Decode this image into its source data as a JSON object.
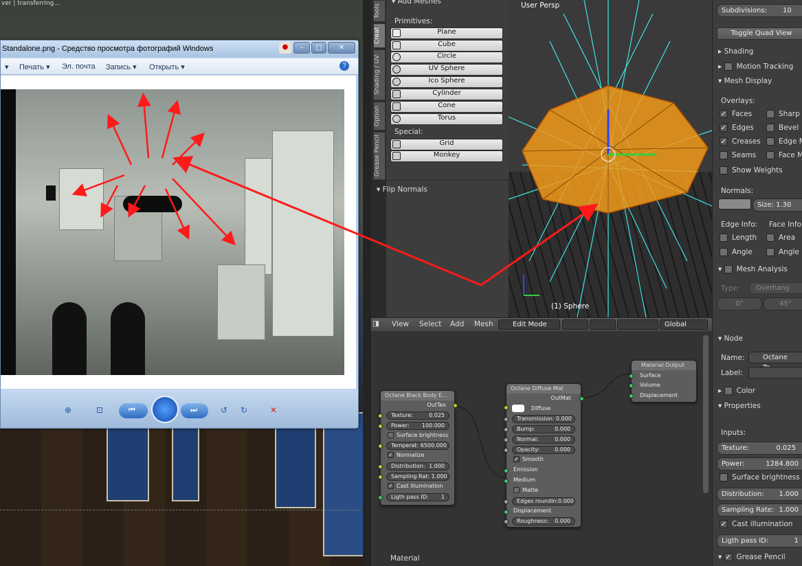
{
  "background": {
    "title_fragment": "ver | transferring..."
  },
  "viewer": {
    "title": "Standalone.png - Средство просмотра фотографий Windows",
    "menu": [
      "Печать ▾",
      "Эл. почта",
      "Запись ▾",
      "Открыть ▾"
    ],
    "help": "?"
  },
  "tool_tabs": [
    "Tools",
    "Creat",
    "Shading / UV",
    "Option",
    "Grease Pencil"
  ],
  "tool_shelf": {
    "header": "▾ Add Meshes",
    "primitives_label": "Primitives:",
    "primitives": [
      "Plane",
      "Cube",
      "Circle",
      "UV Sphere",
      "Ico Sphere",
      "Cylinder",
      "Cone",
      "Torus"
    ],
    "special_label": "Special:",
    "special": [
      "Grid",
      "Monkey"
    ],
    "flip_normals": "▾ Flip Normals"
  },
  "viewport": {
    "label": "User Persp",
    "object": "(1) Sphere"
  },
  "viewport_header": {
    "view": "View",
    "select": "Select",
    "add": "Add",
    "mesh": "Mesh",
    "mode": "Edit Mode",
    "orientation": "Global"
  },
  "props": {
    "subdivisions_label": "Subdivisions:",
    "subdivisions_value": "10",
    "toggle_quad": "Toggle Quad View",
    "shading": "▸ Shading",
    "motion_tracking": "Motion Tracking",
    "mesh_display": "▾ Mesh Display",
    "overlays_label": "Overlays:",
    "overlays_left": [
      "Faces",
      "Edges",
      "Creases",
      "Seams"
    ],
    "overlays_left_checked": [
      true,
      true,
      true,
      false
    ],
    "overlays_right": [
      "Sharp",
      "Bevel",
      "Edge M",
      "Face M"
    ],
    "show_weights": "Show Weights",
    "normals_label": "Normals:",
    "size_label": "Size:",
    "size_value": "1.30",
    "edge_info": "Edge Info:",
    "face_info": "Face Info:",
    "length": "Length",
    "area": "Area",
    "angle_left": "Angle",
    "angle_right": "Angle",
    "mesh_analysis": "Mesh Analysis",
    "type_label": "Type:",
    "type_value": "Overhang",
    "angle_min": "0°",
    "angle_max": "45°"
  },
  "node_props": {
    "node": "▾ Node",
    "name_label": "Name:",
    "name_value": "Octane Te...",
    "label_label": "Label:",
    "color": "Color",
    "properties": "▾ Properties",
    "inputs_label": "Inputs:",
    "texture_label": "Texture:",
    "texture_value": "0.025",
    "power_label": "Power:",
    "power_value": "1284.800",
    "surface_brightness": "Surface brightness",
    "distribution_label": "Distribution:",
    "distribution_value": "1.000",
    "sampling_label": "Sampling Rate:",
    "sampling_value": "1.000",
    "cast_illumination": "Cast illumination",
    "light_pass_label": "Ligth pass ID:",
    "light_pass_value": "1",
    "grease_pencil": "Grease Pencil"
  },
  "node_editor": {
    "footer": "Material",
    "blackbody": {
      "title": "Octane Black Body E...",
      "out": "OutTex",
      "texture": "Texture:",
      "texture_v": "0.025",
      "power": "Power:",
      "power_v": "100.000",
      "surface": "Surface brightness",
      "temperat": "Temperat: 6500.000",
      "normalize": "Normalize",
      "distribution": "Distribution:",
      "distribution_v": "1.000",
      "sampling": "Sampling Rat: 1.000",
      "cast": "Cast illumination",
      "ligth": "Ligth pass ID:",
      "ligth_v": "1"
    },
    "diffuse": {
      "title": "Octane Diffuse Mat",
      "out": "OutMat",
      "diffuse": "Diffuse",
      "transmission": "Transmission: 0.000",
      "bump": "Bump:",
      "bump_v": "0.000",
      "normal": "Normal:",
      "normal_v": "0.000",
      "opacity": "Opacity:",
      "opacity_v": "0.000",
      "smooth": "Smooth",
      "emission": "Emission",
      "medium": "Medium",
      "matte": "Matte",
      "edges": "Edges roundin:0.000",
      "displacement": "Displacement",
      "roughness": "Roughness:",
      "roughness_v": "0.000"
    },
    "output": {
      "title": "Material Output",
      "surface": "Surface",
      "volume": "Volume",
      "displacement": "Displacement"
    }
  },
  "colors": {
    "annotation_arrow": "#ff1a1a",
    "mesh_orange": "#f29a1a",
    "cyan_lines": "#3fe6e6"
  }
}
